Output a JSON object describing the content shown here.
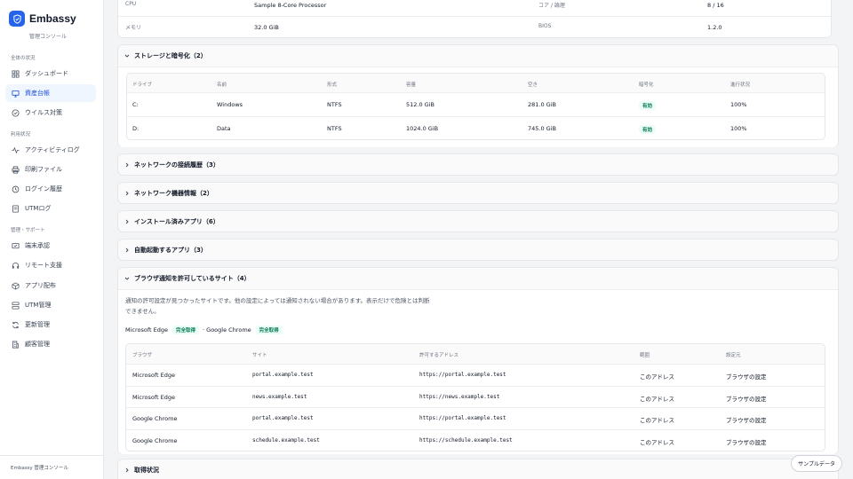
{
  "brand": {
    "name": "Embassy",
    "subtitle": "管理コンソール"
  },
  "sidebar": {
    "section_overview": "全体の状況",
    "items_overview": [
      {
        "label": "ダッシュボード",
        "icon": "grid-icon"
      },
      {
        "label": "資産台帳",
        "icon": "monitor-icon"
      },
      {
        "label": "ウイルス対策",
        "icon": "shield-check-icon"
      }
    ],
    "section_usage": "利用状況",
    "items_usage": [
      {
        "label": "アクティビティログ",
        "icon": "activity-icon"
      },
      {
        "label": "印刷ファイル",
        "icon": "printer-icon"
      },
      {
        "label": "ログイン履歴",
        "icon": "history-icon"
      },
      {
        "label": "UTMログ",
        "icon": "file-icon"
      }
    ],
    "section_admin": "管理・サポート",
    "items_admin": [
      {
        "label": "端末承認",
        "icon": "device-check-icon"
      },
      {
        "label": "リモート支援",
        "icon": "headset-icon"
      },
      {
        "label": "アプリ配布",
        "icon": "package-icon"
      },
      {
        "label": "UTM管理",
        "icon": "network-icon"
      },
      {
        "label": "更新管理",
        "icon": "refresh-icon"
      },
      {
        "label": "顧客管理",
        "icon": "building-icon"
      }
    ],
    "footer": "Embassy 管理コンソール"
  },
  "system": {
    "rows": [
      {
        "k1": "CPU",
        "v1": "Sample 8-Core Processor",
        "k2": "コア / 論理",
        "v2": "8 / 16"
      },
      {
        "k1": "メモリ",
        "v1": "32.0 GiB",
        "k2": "BIOS",
        "v2": "1.2.0"
      }
    ]
  },
  "storage": {
    "title": "ストレージと暗号化（2）",
    "headers": [
      "ドライブ",
      "名前",
      "形式",
      "容量",
      "空き",
      "暗号化",
      "進行状況"
    ],
    "rows": [
      {
        "drive": "C:",
        "name": "Windows",
        "format": "NTFS",
        "capacity": "512.0 GiB",
        "free": "281.0 GiB",
        "enc": "有効",
        "progress": "100%"
      },
      {
        "drive": "D:",
        "name": "Data",
        "format": "NTFS",
        "capacity": "1024.0 GiB",
        "free": "745.0 GiB",
        "enc": "有効",
        "progress": "100%"
      }
    ]
  },
  "sections": {
    "network_history": "ネットワークの接続履歴（3）",
    "network_devices": "ネットワーク機器情報（2）",
    "installed_apps": "インストール済みアプリ（6）",
    "startup_apps": "自動起動するアプリ（3）",
    "acquisition": "取得状況"
  },
  "notifications": {
    "title": "ブラウザ通知を許可しているサイト（4）",
    "notice": "通知の許可設定が見つかったサイトです。他の設定によっては通知されない場合があります。表示だけで危険とは判断できません。",
    "browser1": "Microsoft Edge",
    "status1": "完全取得",
    "sep": "· Google Chrome",
    "status2": "完全取得",
    "headers": [
      "ブラウザ",
      "サイト",
      "許可するアドレス",
      "範囲",
      "設定元"
    ],
    "rows": [
      {
        "browser": "Microsoft Edge",
        "site": "portal.example.test",
        "addr": "https://portal.example.test",
        "scope": "このアドレス",
        "source": "ブラウザの設定"
      },
      {
        "browser": "Microsoft Edge",
        "site": "news.example.test",
        "addr": "https://news.example.test",
        "scope": "このアドレス",
        "source": "ブラウザの設定"
      },
      {
        "browser": "Google Chrome",
        "site": "portal.example.test",
        "addr": "https://portal.example.test",
        "scope": "このアドレス",
        "source": "ブラウザの設定"
      },
      {
        "browser": "Google Chrome",
        "site": "schedule.example.test",
        "addr": "https://schedule.example.test",
        "scope": "このアドレス",
        "source": "ブラウザの設定"
      }
    ]
  },
  "sample_label": "サンプルデータ"
}
